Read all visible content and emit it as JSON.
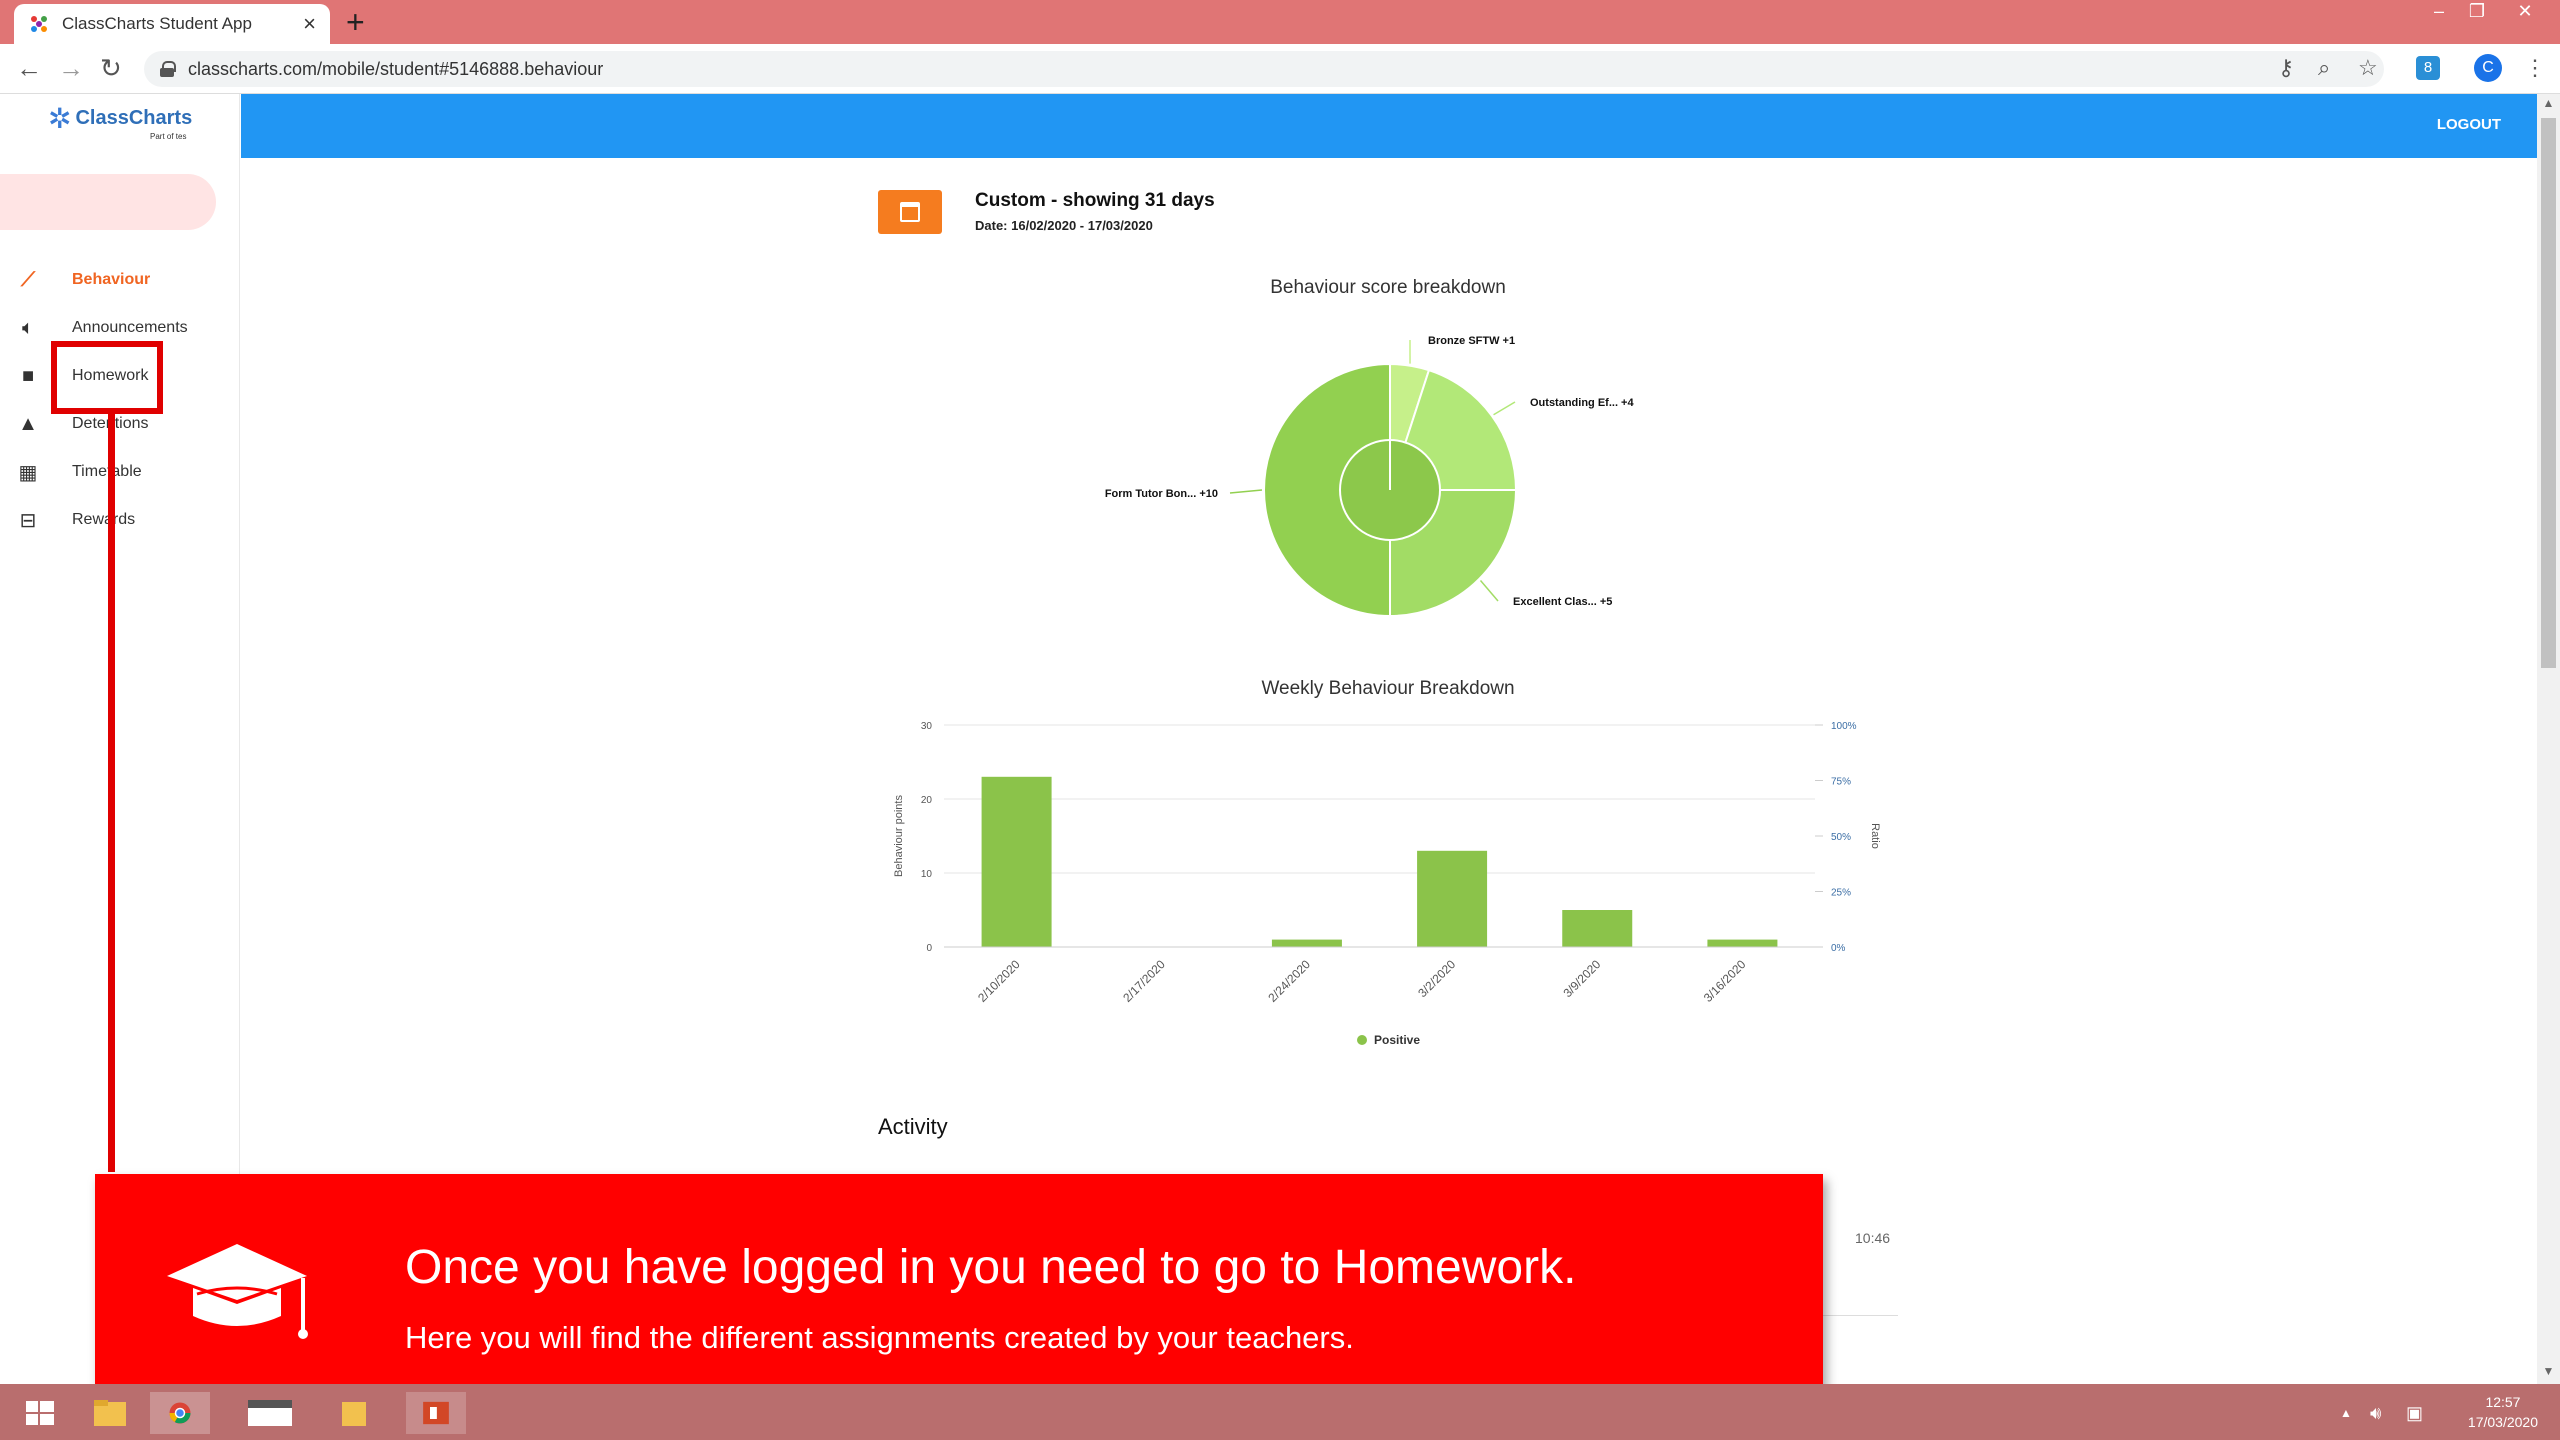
{
  "browser": {
    "tab_title": "ClassCharts Student App",
    "url": "classcharts.com/mobile/student#5146888.behaviour",
    "profile_initial": "C",
    "extension_badge": "8"
  },
  "sidebar": {
    "logo_text": "ClassCharts",
    "logo_sub": "Part of tes",
    "items": [
      {
        "label": "Behaviour",
        "icon": "trend-icon"
      },
      {
        "label": "Announcements",
        "icon": "speaker-icon"
      },
      {
        "label": "Homework",
        "icon": "briefcase-icon"
      },
      {
        "label": "Detentions",
        "icon": "warning-icon"
      },
      {
        "label": "Timetable",
        "icon": "table-icon"
      },
      {
        "label": "Rewards",
        "icon": "gift-icon"
      }
    ]
  },
  "header": {
    "logout_label": "LOGOUT"
  },
  "range": {
    "title": "Custom - showing 31 days",
    "date": "Date: 16/02/2020 - 17/03/2020"
  },
  "charts": {
    "pie_title": "Behaviour score breakdown",
    "bar_title": "Weekly Behaviour Breakdown"
  },
  "chart_data": [
    {
      "type": "pie",
      "title": "Behaviour score breakdown",
      "labels": [
        "Bronze SFTW +1",
        "Outstanding Ef... +4",
        "Excellent Clas... +5",
        "Form Tutor Bon... +10"
      ],
      "values": [
        1,
        4,
        5,
        10
      ],
      "colors": [
        "#c6f08a",
        "#b2e878",
        "#a2dc65",
        "#92d050"
      ]
    },
    {
      "type": "bar",
      "title": "Weekly Behaviour Breakdown",
      "categories": [
        "2/10/2020",
        "2/17/2020",
        "2/24/2020",
        "3/2/2020",
        "3/9/2020",
        "3/16/2020"
      ],
      "series": [
        {
          "name": "Positive",
          "values": [
            23,
            0,
            1,
            13,
            5,
            1
          ],
          "color": "#8bc34a"
        }
      ],
      "ylabel": "Behaviour points",
      "y2label": "Ratio",
      "ylim": [
        0,
        30
      ],
      "yticks": [
        "0",
        "10",
        "20",
        "30"
      ],
      "y2ticks": [
        "0%",
        "25%",
        "50%",
        "75%",
        "100%"
      ],
      "legend": "bottom-center",
      "grid": true
    }
  ],
  "activity": {
    "heading": "Activity",
    "time": "10:46"
  },
  "banner": {
    "title": "Once you have logged in you need to go to Homework.",
    "subtitle": "Here you will find the different assignments created by your teachers."
  },
  "taskbar": {
    "time": "12:57",
    "date": "17/03/2020"
  }
}
